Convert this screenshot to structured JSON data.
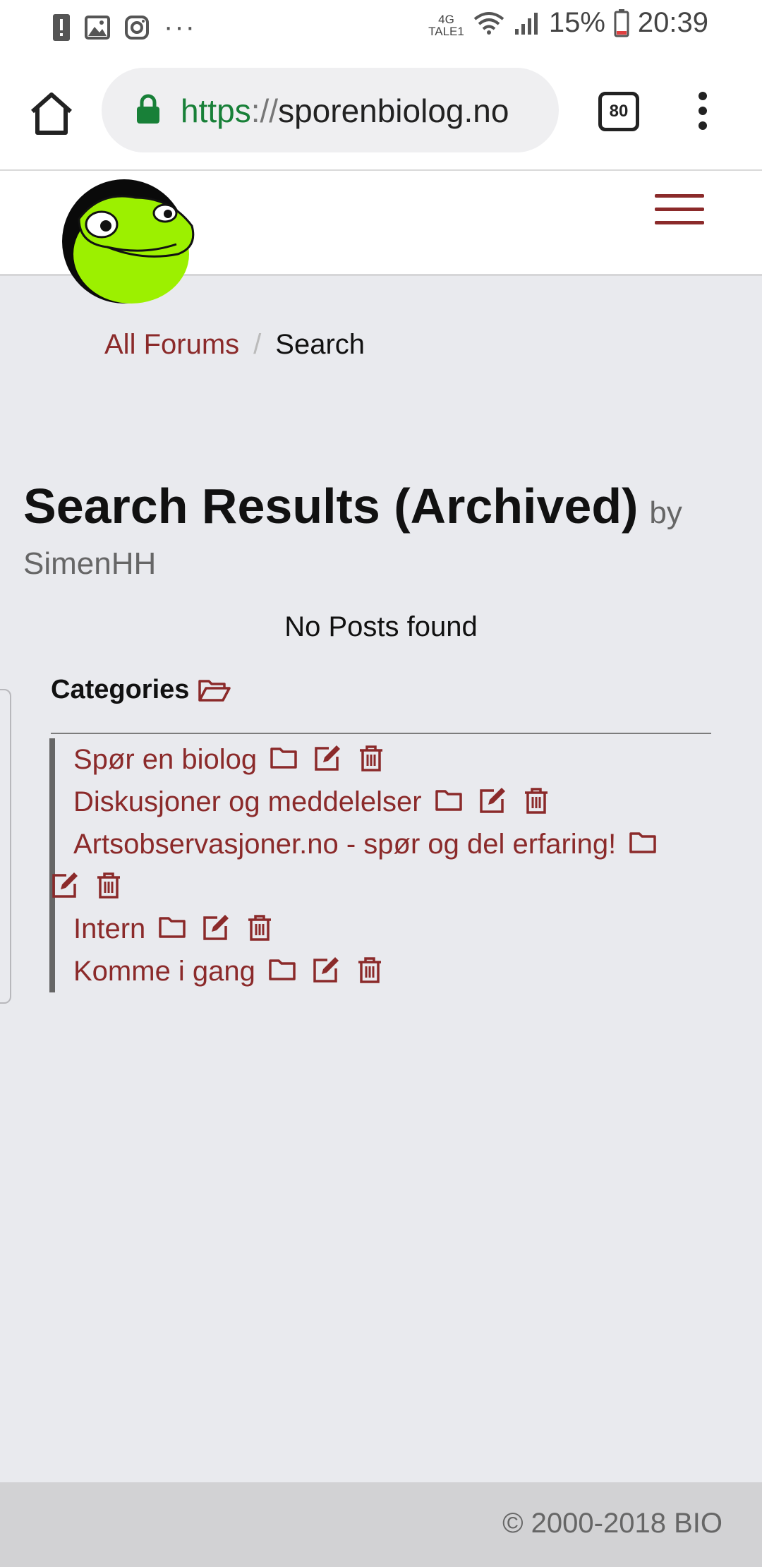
{
  "status_bar": {
    "network_top": "4G",
    "network_bottom": "TALE1",
    "battery": "15%",
    "time": "20:39",
    "more": "···"
  },
  "browser": {
    "url_scheme": "https",
    "url_sep": "://",
    "url_host": "sporenbiolog.no",
    "tab_count": "80"
  },
  "breadcrumb": {
    "link": "All Forums",
    "separator": "/",
    "current": "Search"
  },
  "page": {
    "title": "Search Results (Archived)",
    "by": "by",
    "author": "SimenHH",
    "empty_message": "No Posts found"
  },
  "categories": {
    "heading": "Categories",
    "items": [
      {
        "label": "Spør en biolog"
      },
      {
        "label": "Diskusjoner og meddelelser"
      },
      {
        "label": "Artsobservasjoner.no - spør og del erfaring!"
      },
      {
        "label": "Intern"
      },
      {
        "label": "Komme i gang"
      }
    ]
  },
  "footer": {
    "copyright": "© 2000-2018 BIO"
  },
  "colors": {
    "accent": "#8b2a2a",
    "page_bg": "#e9eaee",
    "footer_bg": "#d2d2d4"
  }
}
